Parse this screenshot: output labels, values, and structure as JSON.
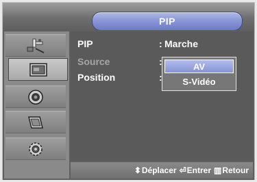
{
  "header": {
    "title": "PIP"
  },
  "sidebar": {
    "items": [
      {
        "name": "input-icon"
      },
      {
        "name": "picture-icon"
      },
      {
        "name": "sound-icon"
      },
      {
        "name": "channel-icon"
      },
      {
        "name": "setup-icon"
      }
    ],
    "active_index": 1
  },
  "menu": {
    "rows": [
      {
        "label": "PIP",
        "sep": ":",
        "value": "Marche"
      },
      {
        "label": "Source",
        "sep": ":",
        "value": ""
      },
      {
        "label": "Position",
        "sep": ":",
        "value": ""
      }
    ],
    "dropdown": {
      "selected": "AV",
      "other": "S-Vidéo"
    }
  },
  "footer": {
    "move_label": "Déplacer",
    "enter_label": "Entrer",
    "return_label": "Retour"
  },
  "colors": {
    "accent": "#8b98d7",
    "background": "#5f5f5f"
  }
}
